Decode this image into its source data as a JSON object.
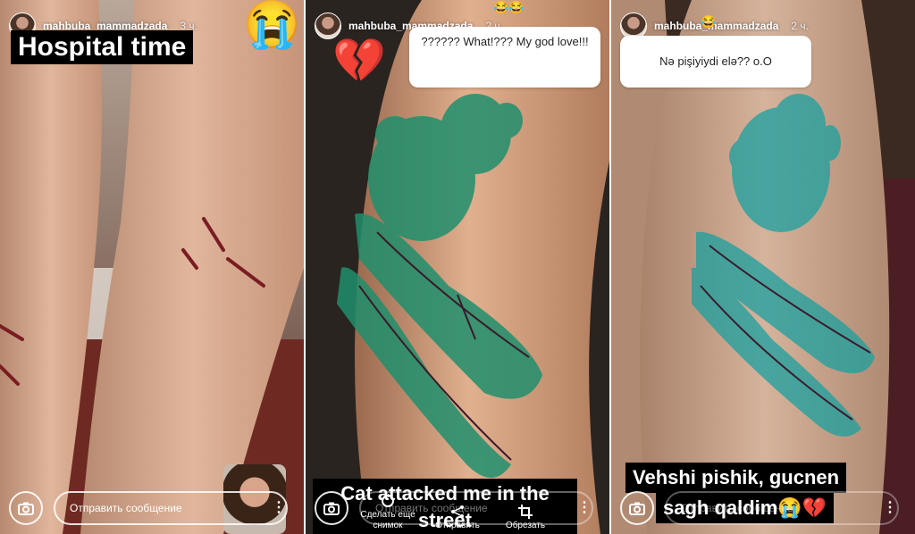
{
  "panels": [
    {
      "username": "mahbuba_mammadzada",
      "time": "3 ч.",
      "caption": "Hospital time",
      "caption_emoji": "😭",
      "message_placeholder": "Отправить сообщение",
      "more_glyph": "⋮"
    },
    {
      "username": "mahbuba_mammadzada",
      "time": "2 ч.",
      "top_emojis": "😂😂",
      "sticker_emoji": "💔",
      "question": "?????? What!??? My god love!!!",
      "caption": "Cat attacked me in the street",
      "message_placeholder": "Отправить сообщение",
      "actions": [
        "Сделать еще снимок",
        "Отправить",
        "Обрезать"
      ],
      "more_glyph": "⋮"
    },
    {
      "username": "mahbuba_mammadzada",
      "time": "2 ч.",
      "name_emoji": "😂",
      "question": "Nə pişiyiydi elə?? o.O",
      "caption_line1": "Vehshi pishik, gucnen",
      "caption_line2": "sagh qaldim😭💔",
      "message_placeholder": "Отправить сообщение",
      "more_glyph": "⋮"
    }
  ],
  "icons": [
    "camera-icon",
    "more-icon",
    "retake-icon",
    "send-icon",
    "crop-icon",
    "broken-heart-icon",
    "crying-face-icon"
  ],
  "colors": {
    "bandage_green": "#1f8f6d",
    "skin": "#d9a98c",
    "caption_bg": "#000000"
  }
}
